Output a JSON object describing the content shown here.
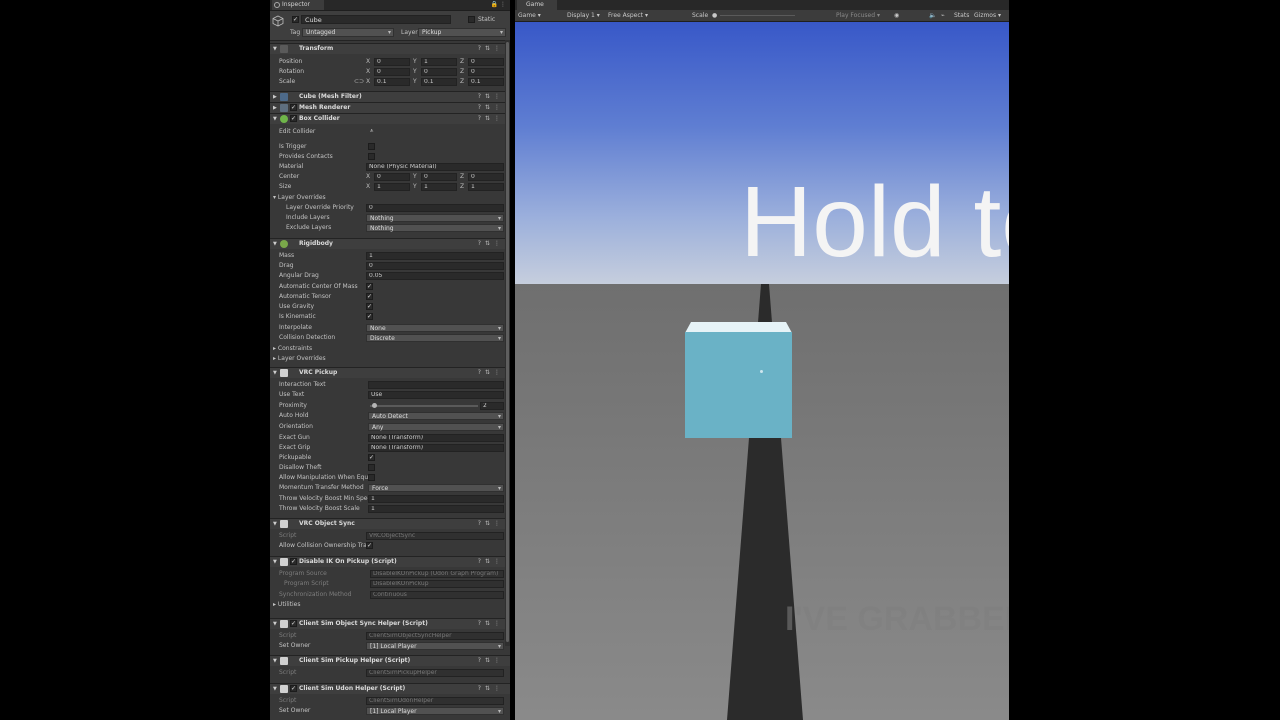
{
  "inspector": {
    "tab_label": "Inspector",
    "object_name": "Cube",
    "static_label": "Static",
    "tag_label": "Tag",
    "tag_value": "Untagged",
    "layer_label": "Layer",
    "layer_value": "Pickup"
  },
  "transform": {
    "title": "Transform",
    "position_label": "Position",
    "rotation_label": "Rotation",
    "scale_label": "Scale",
    "position": {
      "x": "0",
      "y": "1",
      "z": "0"
    },
    "rotation": {
      "x": "0",
      "y": "0",
      "z": "0"
    },
    "scale": {
      "x": "0.1",
      "y": "0.1",
      "z": "0.1"
    }
  },
  "mesh_filter": {
    "title": "Cube (Mesh Filter)"
  },
  "mesh_renderer": {
    "title": "Mesh Renderer"
  },
  "box_collider": {
    "title": "Box Collider",
    "edit_collider": "Edit Collider",
    "is_trigger": "Is Trigger",
    "provides_contacts": "Provides Contacts",
    "material_label": "Material",
    "material_value": "None (Physic Material)",
    "center_label": "Center",
    "center": {
      "x": "0",
      "y": "0",
      "z": "0"
    },
    "size_label": "Size",
    "size": {
      "x": "1",
      "y": "1",
      "z": "1"
    },
    "layer_overrides": "Layer Overrides",
    "priority_label": "Layer Override Priority",
    "priority_value": "0",
    "include_label": "Include Layers",
    "include_value": "Nothing",
    "exclude_label": "Exclude Layers",
    "exclude_value": "Nothing"
  },
  "rigidbody": {
    "title": "Rigidbody",
    "mass_label": "Mass",
    "mass": "1",
    "drag_label": "Drag",
    "drag": "0",
    "angular_drag_label": "Angular Drag",
    "angular_drag": "0.05",
    "auto_com": "Automatic Center Of Mass",
    "auto_tensor": "Automatic Tensor",
    "use_gravity": "Use Gravity",
    "is_kinematic": "Is Kinematic",
    "interpolate_label": "Interpolate",
    "interpolate": "None",
    "collision_label": "Collision Detection",
    "collision": "Discrete",
    "constraints": "Constraints",
    "layer_overrides": "Layer Overrides"
  },
  "vrc_pickup": {
    "title": "VRC Pickup",
    "interaction_text": "Interaction Text",
    "use_text_label": "Use Text",
    "use_text": "Use",
    "proximity_label": "Proximity",
    "proximity": "2",
    "proximity_fraction": 0.02,
    "auto_hold_label": "Auto Hold",
    "auto_hold": "Auto Detect",
    "orientation_label": "Orientation",
    "orientation": "Any",
    "exact_gun_label": "Exact Gun",
    "exact_gun": "None (Transform)",
    "exact_grip_label": "Exact Grip",
    "exact_grip": "None (Transform)",
    "pickupable": "Pickupable",
    "disallow_theft": "Disallow Theft",
    "allow_manip": "Allow Manipulation When Equip",
    "momentum_label": "Momentum Transfer Method",
    "momentum": "Force",
    "boost_min_label": "Throw Velocity Boost Min Spee",
    "boost_min": "1",
    "boost_scale_label": "Throw Velocity Boost Scale",
    "boost_scale": "1"
  },
  "vrc_object_sync": {
    "title": "VRC Object Sync",
    "script_label": "Script",
    "script": "VRCObjectSync",
    "allow_collision": "Allow Collision Ownership Tra"
  },
  "disable_ik": {
    "title": "Disable IK On Pickup (Script)",
    "program_label": "Program Source",
    "program": "DisableIKOnPickup (Udon Graph Program)",
    "asset_label": "Program Script",
    "asset": "DisableIKOnPickup",
    "sync_label": "Synchronization Method",
    "sync": "Continuous",
    "utilities": "Utilities"
  },
  "cs_object_sync": {
    "title": "Client Sim Object Sync Helper (Script)",
    "script_label": "Script",
    "script": "ClientSimObjectSyncHelper",
    "owner_label": "Set Owner",
    "owner": "[1] Local Player"
  },
  "cs_pickup": {
    "title": "Client Sim Pickup Helper (Script)",
    "script_label": "Script",
    "script": "ClientSimPickupHelper"
  },
  "cs_udon": {
    "title": "Client Sim Udon Helper (Script)",
    "script_label": "Script",
    "script": "ClientSimUdonHelper",
    "owner_label": "Set Owner",
    "owner": "[1] Local Player"
  },
  "game": {
    "tab_label": "Game",
    "mode": "Game",
    "display": "Display 1",
    "aspect": "Free Aspect",
    "scale_label": "Scale",
    "scale_value": "1x",
    "play_focused": "Play Focused",
    "stats": "Stats",
    "gizmos": "Gizmos",
    "hold_text": "Hold to",
    "faint_text": "I'VE GRABBED"
  },
  "colors": {
    "panel": "#383838",
    "cube": "#6ab2c6",
    "sky_top": "#3858c8",
    "ground": "#7a7a7a"
  }
}
